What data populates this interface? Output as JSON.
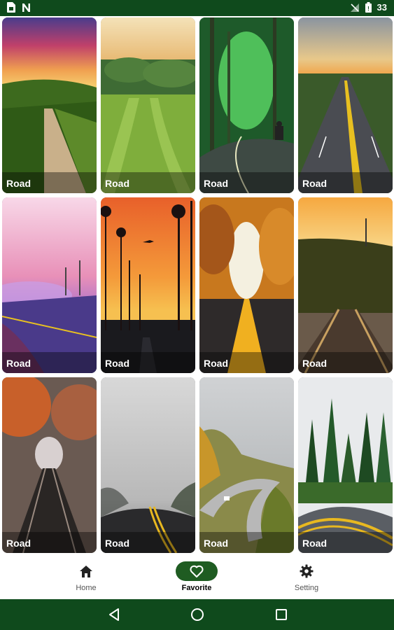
{
  "status_bar": {
    "time": "33",
    "icons": [
      "sim-card-icon",
      "n-notification-icon",
      "no-signal-icon",
      "battery-icon"
    ]
  },
  "wallpapers": [
    {
      "label": "Road"
    },
    {
      "label": "Road"
    },
    {
      "label": "Road"
    },
    {
      "label": "Road"
    },
    {
      "label": "Road"
    },
    {
      "label": "Road"
    },
    {
      "label": "Road"
    },
    {
      "label": "Road"
    },
    {
      "label": "Road"
    },
    {
      "label": "Road"
    },
    {
      "label": "Road"
    },
    {
      "label": "Road"
    }
  ],
  "bottom_nav": {
    "items": [
      {
        "label": "Home",
        "icon": "home-icon",
        "active": false
      },
      {
        "label": "Favorite",
        "icon": "heart-icon",
        "active": true
      },
      {
        "label": "Setting",
        "icon": "gear-icon",
        "active": false
      }
    ],
    "active_color": "#1f5c22"
  },
  "system_nav": {
    "icons": [
      "back-icon",
      "home-circle-icon",
      "recents-icon"
    ]
  },
  "colors": {
    "status_bar": "#0f4a1c",
    "nav_active": "#1f5c22"
  }
}
